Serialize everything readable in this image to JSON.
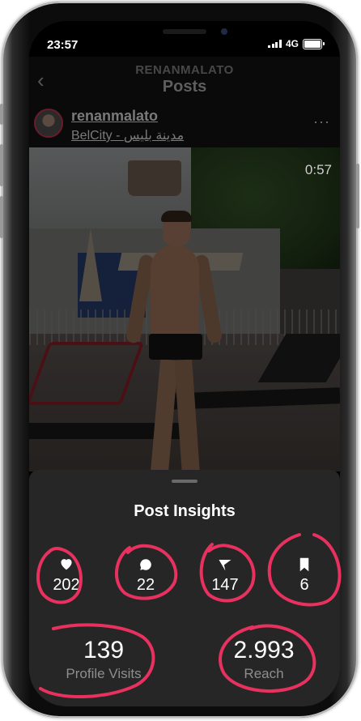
{
  "status_bar": {
    "time": "23:57",
    "network": "4G"
  },
  "header": {
    "username": "RENANMALATO",
    "title": "Posts"
  },
  "post": {
    "author": "renanmalato",
    "location": "BelCity - مدينة بليس",
    "more_label": "···",
    "video_duration": "0:57"
  },
  "insights": {
    "title": "Post Insights",
    "likes": "202",
    "comments": "22",
    "shares": "147",
    "saves": "6",
    "profile_visits": {
      "value": "139",
      "label": "Profile Visits"
    },
    "reach": {
      "value": "2.993",
      "label": "Reach"
    }
  },
  "colors": {
    "annotation": "#e8315f",
    "sheet_background": "#262626",
    "screen_background": "#000000"
  },
  "icons": [
    "back-arrow-icon",
    "more-options-icon",
    "heart-icon",
    "comment-icon",
    "send-icon",
    "bookmark-icon",
    "signal-icon",
    "battery-icon"
  ]
}
